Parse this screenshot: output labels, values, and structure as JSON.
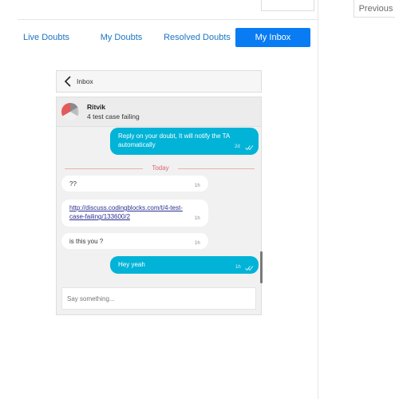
{
  "pagination": {
    "previous_label": "Previous"
  },
  "tabs": [
    {
      "label": "Live Doubts",
      "active": false
    },
    {
      "label": "My Doubts",
      "active": false
    },
    {
      "label": "Resolved Doubts",
      "active": false
    },
    {
      "label": "My Inbox",
      "active": true
    }
  ],
  "chat": {
    "header_title": "Inbox",
    "user": {
      "name": "Ritvik",
      "status": "4 test case failing"
    },
    "divider_label": "Today",
    "messages": [
      {
        "direction": "out",
        "line1": "Reply on your doubt, It will notify the TA",
        "line2": "automatically",
        "time": "2d"
      },
      {
        "direction": "in",
        "text": "??",
        "time": "1h"
      },
      {
        "direction": "in",
        "link_line1": "http://discuss.codingblocks.com/t/4-test-",
        "link_line2": "case-failing/133600/2",
        "time": "1h"
      },
      {
        "direction": "in",
        "text": "is this you ?",
        "time": "1h"
      },
      {
        "direction": "out",
        "text": "Hey yeah",
        "time": "1h"
      }
    ],
    "input_placeholder": "Say something..."
  },
  "colors": {
    "accent": "#0a7cf3",
    "bubble_out": "#00b3d7",
    "today": "#e06473"
  }
}
